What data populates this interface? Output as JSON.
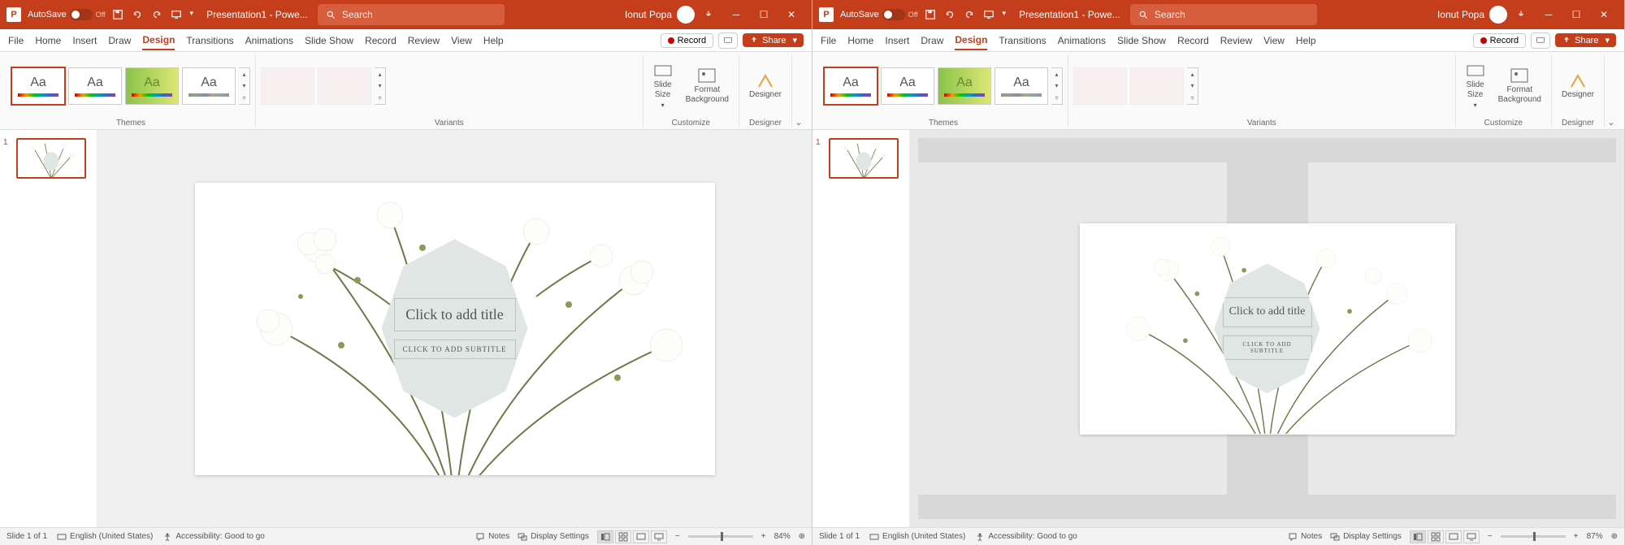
{
  "titlebar": {
    "autosave_label": "AutoSave",
    "autosave_state": "Off",
    "filename": "Presentation1 - Powe...",
    "search_placeholder": "Search",
    "user_name": "Ionut Popa"
  },
  "tabs": {
    "file": "File",
    "home": "Home",
    "insert": "Insert",
    "draw": "Draw",
    "design": "Design",
    "transitions": "Transitions",
    "animations": "Animations",
    "slideshow": "Slide Show",
    "record": "Record",
    "review": "Review",
    "view": "View",
    "help": "Help",
    "record_btn": "Record",
    "share_btn": "Share"
  },
  "ribbon": {
    "themes_label": "Themes",
    "variants_label": "Variants",
    "customize_label": "Customize",
    "designer_label": "Designer",
    "slide_size": "Slide\nSize",
    "format_bg": "Format\nBackground",
    "designer_btn": "Designer",
    "theme_aa": "Aa"
  },
  "slide": {
    "number": "1",
    "title_placeholder": "Click to add title",
    "subtitle_placeholder": "CLICK TO ADD SUBTITLE"
  },
  "statusbar": {
    "slide_counter": "Slide 1 of 1",
    "language": "English (United States)",
    "accessibility": "Accessibility: Good to go",
    "notes": "Notes",
    "display_settings": "Display Settings",
    "zoom_left": "84%",
    "zoom_right": "87%"
  }
}
